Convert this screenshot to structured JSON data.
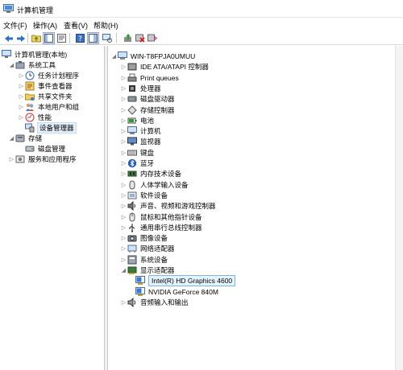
{
  "window": {
    "title": "计算机管理"
  },
  "menu": [
    {
      "label": "文件(F)"
    },
    {
      "label": "操作(A)"
    },
    {
      "label": "查看(V)"
    },
    {
      "label": "帮助(H)"
    }
  ],
  "toolbar": {
    "buttons": [
      {
        "name": "back-icon"
      },
      {
        "name": "forward-icon"
      },
      {
        "name": "folder-up-icon"
      },
      {
        "name": "show-hide-tree-icon"
      },
      {
        "name": "properties-icon"
      },
      {
        "name": "help-icon"
      },
      {
        "name": "console-view-icon"
      },
      {
        "name": "update-driver-icon"
      },
      {
        "name": "uninstall-device-icon"
      },
      {
        "name": "scan-hardware-icon"
      }
    ]
  },
  "left_tree": {
    "root": "计算机管理(本地)",
    "items": [
      {
        "label": "系统工具",
        "level": 1,
        "expander": "expanded",
        "icon": "tools-icon"
      },
      {
        "label": "任务计划程序",
        "level": 2,
        "expander": "collapsed",
        "icon": "clock-icon"
      },
      {
        "label": "事件查看器",
        "level": 2,
        "expander": "collapsed",
        "icon": "event-viewer-icon"
      },
      {
        "label": "共享文件夹",
        "level": 2,
        "expander": "collapsed",
        "icon": "shared-folder-icon"
      },
      {
        "label": "本地用户和组",
        "level": 2,
        "expander": "collapsed",
        "icon": "users-icon"
      },
      {
        "label": "性能",
        "level": 2,
        "expander": "collapsed",
        "icon": "performance-icon"
      },
      {
        "label": "设备管理器",
        "level": 2,
        "expander": "none",
        "icon": "device-manager-icon",
        "selected": true
      },
      {
        "label": "存储",
        "level": 1,
        "expander": "expanded",
        "icon": "storage-icon"
      },
      {
        "label": "磁盘管理",
        "level": 2,
        "expander": "none",
        "icon": "disk-management-icon"
      },
      {
        "label": "服务和应用程序",
        "level": 1,
        "expander": "collapsed",
        "icon": "services-icon"
      }
    ]
  },
  "device_tree": {
    "root": "WIN-T8FPJA0UMUU",
    "categories": [
      {
        "label": "IDE ATA/ATAPI 控制器",
        "icon": "ide-controller-icon",
        "expander": "collapsed"
      },
      {
        "label": "Print queues",
        "icon": "printer-icon",
        "expander": "collapsed"
      },
      {
        "label": "处理器",
        "icon": "processor-icon",
        "expander": "collapsed"
      },
      {
        "label": "磁盘驱动器",
        "icon": "disk-drive-icon",
        "expander": "collapsed"
      },
      {
        "label": "存储控制器",
        "icon": "storage-controller-icon",
        "expander": "collapsed"
      },
      {
        "label": "电池",
        "icon": "battery-icon",
        "expander": "collapsed"
      },
      {
        "label": "计算机",
        "icon": "computer-icon",
        "expander": "collapsed"
      },
      {
        "label": "监视器",
        "icon": "monitor-icon",
        "expander": "collapsed"
      },
      {
        "label": "键盘",
        "icon": "keyboard-icon",
        "expander": "collapsed"
      },
      {
        "label": "蓝牙",
        "icon": "bluetooth-icon",
        "expander": "collapsed"
      },
      {
        "label": "内存技术设备",
        "icon": "memory-device-icon",
        "expander": "collapsed"
      },
      {
        "label": "人体学输入设备",
        "icon": "hid-icon",
        "expander": "collapsed"
      },
      {
        "label": "软件设备",
        "icon": "software-device-icon",
        "expander": "collapsed"
      },
      {
        "label": "声音、视频和游戏控制器",
        "icon": "sound-icon",
        "expander": "collapsed"
      },
      {
        "label": "鼠标和其他指针设备",
        "icon": "mouse-icon",
        "expander": "collapsed"
      },
      {
        "label": "通用串行总线控制器",
        "icon": "usb-icon",
        "expander": "collapsed"
      },
      {
        "label": "图像设备",
        "icon": "imaging-device-icon",
        "expander": "collapsed"
      },
      {
        "label": "网络适配器",
        "icon": "network-adapter-icon",
        "expander": "collapsed"
      },
      {
        "label": "系统设备",
        "icon": "system-device-icon",
        "expander": "collapsed"
      },
      {
        "label": "显示适配器",
        "icon": "display-adapter-icon",
        "expander": "expanded"
      },
      {
        "label": "音频输入和输出",
        "icon": "audio-io-icon",
        "expander": "collapsed"
      }
    ],
    "display_adapters": [
      {
        "label": "Intel(R) HD Graphics 4600",
        "highlighted": true
      },
      {
        "label": "NVIDIA GeForce 840M"
      }
    ]
  },
  "colors": {
    "selection": "#e5f0fb",
    "highlight_border": "#7ab4ea",
    "accent": "#2a6fc9"
  }
}
